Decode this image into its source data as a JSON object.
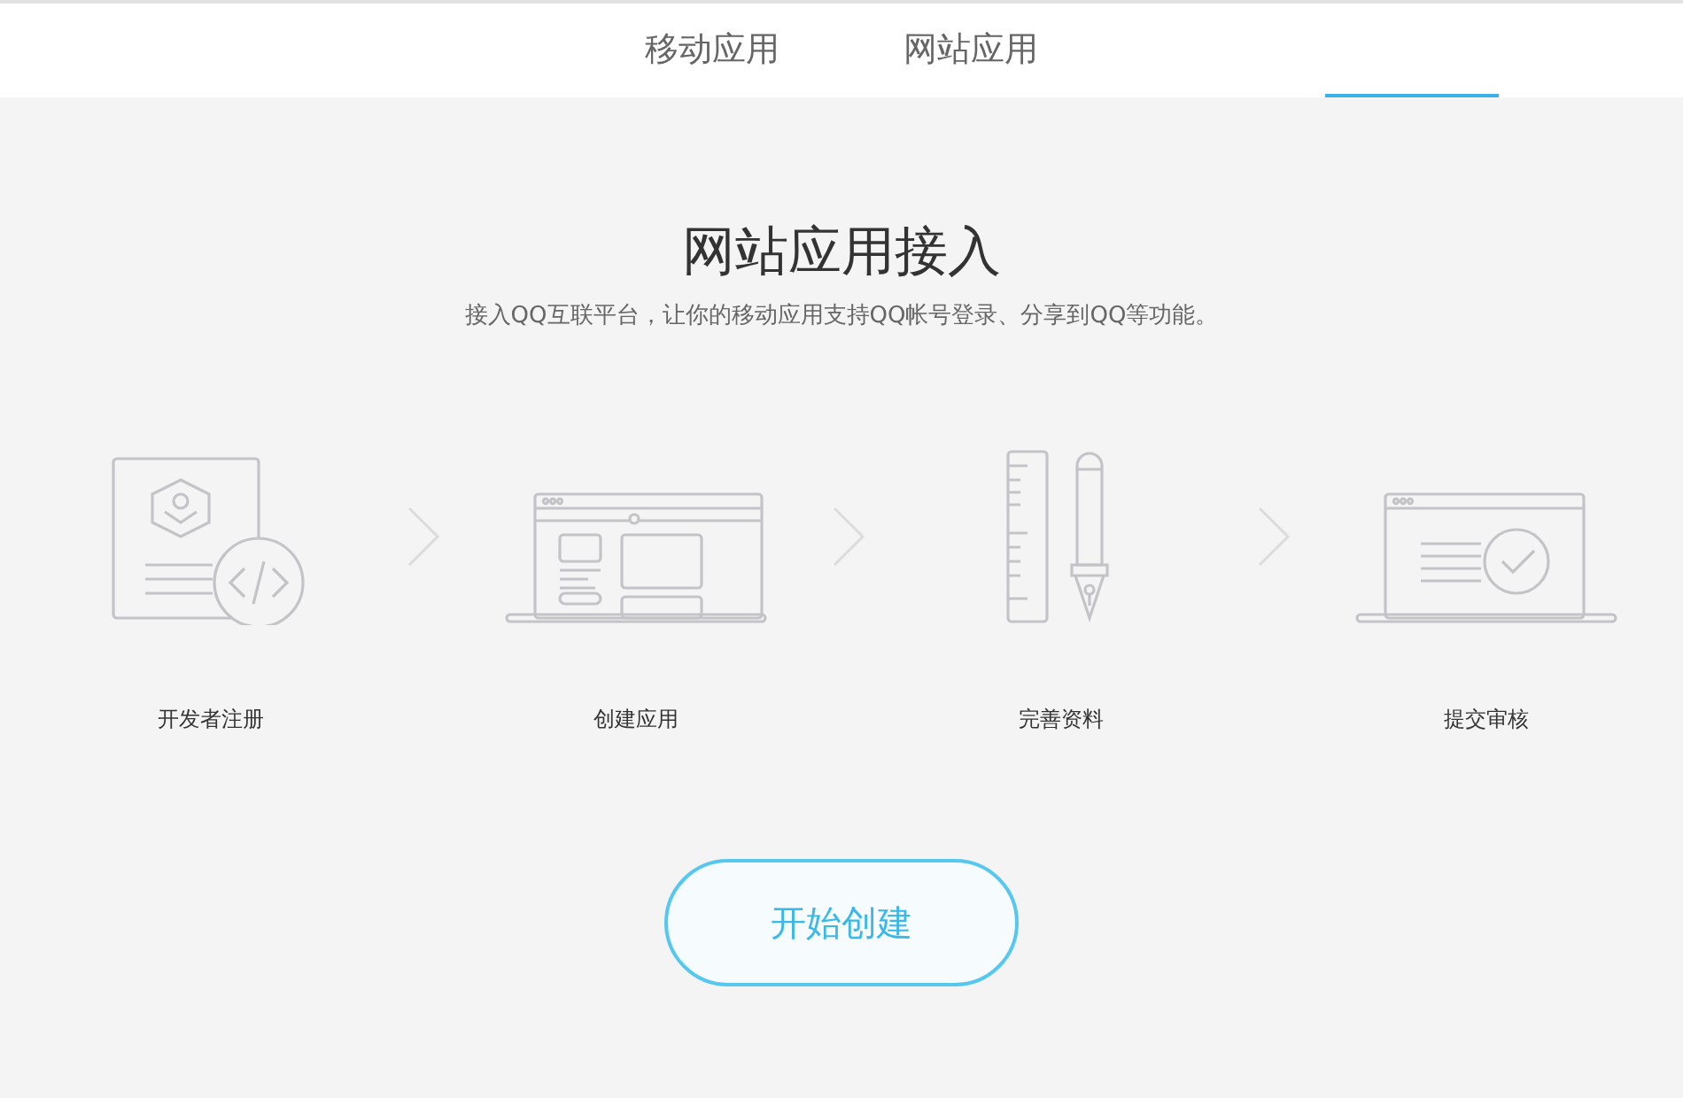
{
  "tabs": [
    {
      "label": "移动应用"
    },
    {
      "label": "网站应用"
    }
  ],
  "heading": "网站应用接入",
  "subtitle": "接入QQ互联平台，让你的移动应用支持QQ帐号登录、分享到QQ等功能。",
  "steps": [
    {
      "kind": "register",
      "label": "开发者注册"
    },
    {
      "kind": "create",
      "label": "创建应用"
    },
    {
      "kind": "profile",
      "label": "完善资料"
    },
    {
      "kind": "submit",
      "label": "提交审核"
    }
  ],
  "start_button": "开始创建"
}
